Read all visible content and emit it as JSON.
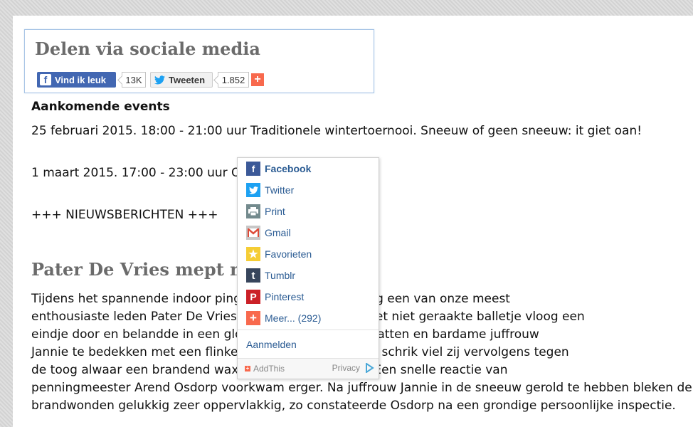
{
  "share": {
    "title": "Delen via sociale media",
    "facebook_label": "Vind ik leuk",
    "facebook_count": "13K",
    "twitter_label": "Tweeten",
    "twitter_count": "1.852",
    "more_symbol": "+"
  },
  "events": {
    "heading": "Aankomende events",
    "line1": "25 februari 2015. 18:00 - 21:00 uur Traditionele wintertoernooi. Sneeuw of geen sneeuw: it giet oan!",
    "line2": "1 maart 2015. 17:00 - 23:00 uur Ope",
    "news_marker": "+++ NIEUWSBERICHTEN +++"
  },
  "article": {
    "title": "Pater De Vries mept mis",
    "lines": [
      "Tijdens het spannende indoor ping-                                 uari jongstleden sloeg een van onze meest",
      "enthousiaste leden Pater De Vries m                                 opmerkelijk, want het niet geraakte balletje vloog een",
      "eindje door en belandde in een gloe                                 gens uit elkaar te spatten en bardame juffrouw",
      "Jannie te bedekken met een flinke s                                 tszins wankel van de schrik viel zij vervolgens tegen",
      "de toog alwaar een brandend waxin                                 n vlam deed staan. Een snelle reactie van",
      "penningmeester Arend Osdorp voorkwam erger. Na juffrouw Jannie in de sneeuw gerold te hebben bleken de",
      "brandwonden gelukkig zeer oppervlakkig, zo constateerde Osdorp na een grondige persoonlijke inspectie."
    ]
  },
  "menu": {
    "items": [
      {
        "label": "Facebook",
        "icon": "facebook-icon",
        "color": "#3b5998",
        "glyph": "f"
      },
      {
        "label": "Twitter",
        "icon": "twitter-icon",
        "color": "#1da1f2",
        "glyph": "t"
      },
      {
        "label": "Print",
        "icon": "print-icon",
        "color": "#738a8d",
        "glyph": "⎙"
      },
      {
        "label": "Gmail",
        "icon": "gmail-icon",
        "color": "#dd4b39",
        "glyph": "M"
      },
      {
        "label": "Favorieten",
        "icon": "star-icon",
        "color": "#f5cd35",
        "glyph": "★"
      },
      {
        "label": "Tumblr",
        "icon": "tumblr-icon",
        "color": "#37455c",
        "glyph": "t"
      },
      {
        "label": "Pinterest",
        "icon": "pinterest-icon",
        "color": "#cb2027",
        "glyph": "P"
      },
      {
        "label": "Meer... (292)",
        "icon": "plus-icon",
        "color": "#f8694d",
        "glyph": "+"
      }
    ],
    "login": "Aanmelden",
    "brand": "AddThis",
    "privacy": "Privacy"
  },
  "colors": {
    "link": "#2a5b93",
    "facebook_button": "#4267b2",
    "addthis_orange": "#f8694d"
  }
}
